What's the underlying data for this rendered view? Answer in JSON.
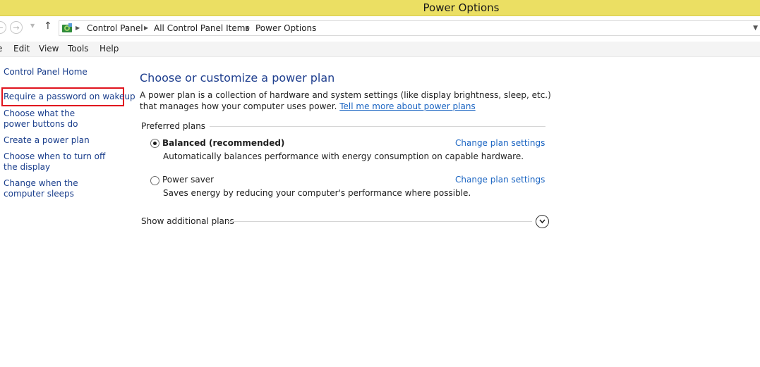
{
  "window": {
    "title": "Power Options"
  },
  "address": {
    "crumbs": [
      "Control Panel",
      "All Control Panel Items",
      "Power Options"
    ]
  },
  "menu": [
    "e",
    "Edit",
    "View",
    "Tools",
    "Help"
  ],
  "sidebar": {
    "items": [
      {
        "label": "Control Panel Home"
      },
      {
        "label": "Require a password on wakeup"
      },
      {
        "label": "Choose what the power buttons do"
      },
      {
        "label": "Create a power plan"
      },
      {
        "label": "Choose when to turn off the display"
      },
      {
        "label": "Change when the computer sleeps"
      }
    ]
  },
  "main": {
    "title": "Choose or customize a power plan",
    "description": "A power plan is a collection of hardware and system settings (like display brightness, sleep, etc.) that manages how your computer uses power.",
    "learn_more": "Tell me more about power plans",
    "group_label": "Preferred plans",
    "plans": [
      {
        "name": "Balanced (recommended)",
        "description": "Automatically balances performance with energy consumption on capable hardware.",
        "selected": true,
        "change_label": "Change plan settings"
      },
      {
        "name": "Power saver",
        "description": "Saves energy by reducing your computer's performance where possible.",
        "selected": false,
        "change_label": "Change plan settings"
      }
    ],
    "show_additional": "Show additional plans"
  },
  "colors": {
    "titlebar": "#ebdf63",
    "link": "#1a64c2",
    "highlight": "#e0141e"
  }
}
